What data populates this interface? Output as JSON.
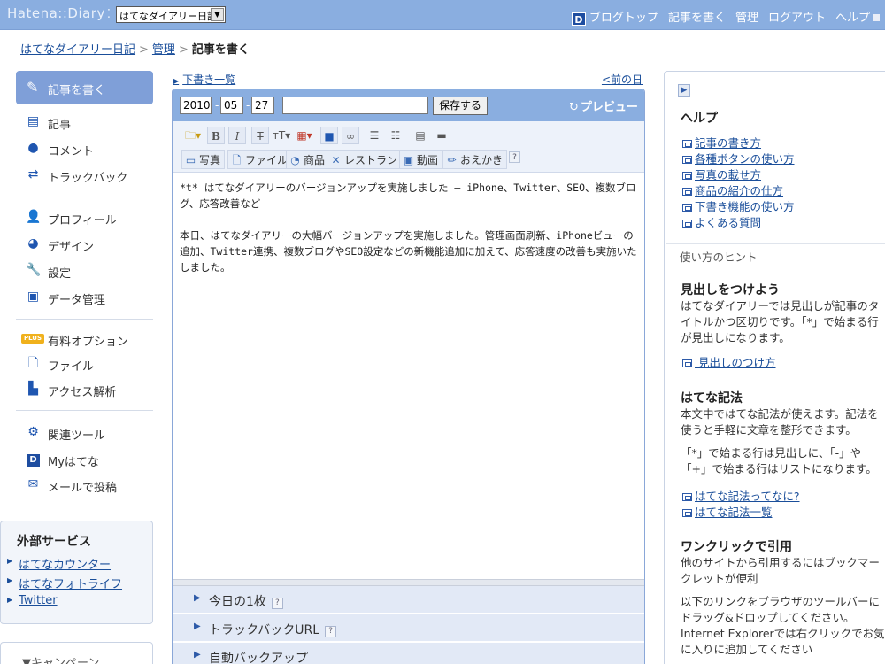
{
  "topbar": {
    "logo": "Hatena::Diary",
    "logo_mark": "⁚",
    "blog_select": "はてなダイアリー日記",
    "nav": [
      "ブログトップ",
      "記事を書く",
      "管理",
      "ログアウト",
      "ヘルプ"
    ],
    "d_badge": "D"
  },
  "breadcrumb": {
    "home": "はてなダイアリー日記",
    "admin": "管理",
    "current": "記事を書く",
    "sep": ">"
  },
  "sidebar": {
    "write_button": "記事を書く",
    "group1": [
      "記事",
      "コメント",
      "トラックバック"
    ],
    "group2": [
      "プロフィール",
      "デザイン",
      "設定",
      "データ管理"
    ],
    "plus_badge": "PLUS",
    "group3": [
      "有料オプション",
      "ファイル",
      "アクセス解析"
    ],
    "group4": [
      "関連ツール",
      "Myはてな",
      "メールで投稿"
    ],
    "external_title": "外部サービス",
    "external_links": [
      "はてなカウンター",
      "はてなフォトライフ",
      "Twitter"
    ],
    "campaign": "キャンペーン"
  },
  "editor": {
    "draft_list": "下書き一覧",
    "prev_day": "<前の日",
    "year": "2010",
    "month": "05",
    "day": "27",
    "title_value": "",
    "save_button": "保存する",
    "preview": "プレビュー",
    "tools_row2": [
      "写真",
      "ファイル",
      "商品",
      "レストラン",
      "動画",
      "おえかき"
    ],
    "help_mark": "?",
    "body": [
      "*t* はてなダイアリーのバージョンアップを実施しました – iPhone、Twitter、SEO、複数ブログ、応答改善など",
      "本日、はてなダイアリーの大幅バージョンアップを実施しました。管理画面刷新、iPhoneビューの追加、Twitter連携、複数ブログやSEO設定などの新機能追加に加えて、応答速度の改善も実施いたしました。"
    ],
    "sections": [
      "今日の1枚",
      "トラックバックURL",
      "自動バックアップ"
    ]
  },
  "help": {
    "title": "ヘルプ",
    "links": [
      "記事の書き方",
      "各種ボタンの使い方",
      "写真の載せ方",
      "商品の紹介の仕方",
      "下書き機能の使い方",
      "よくある質問"
    ],
    "hints_header": "使い方のヒント",
    "h1_title": "見出しをつけよう",
    "h1_text": "はてなダイアリーでは見出しが記事のタイトルかつ区切りです。「*」で始まる行が見出しになります。",
    "h1_link": "見出しのつけ方",
    "h2_title": "はてな記法",
    "h2_text1": "本文中ではてな記法が使えます。記法を使うと手軽に文章を整形できます。",
    "h2_text2": "「*」で始まる行は見出しに、「-」や「+」で始まる行はリストになります。",
    "h2_links": [
      "はてな記法ってなに?",
      "はてな記法一覧"
    ],
    "h3_title": "ワンクリックで引用",
    "h3_text1": "他のサイトから引用するにはブックマークレットが便利",
    "h3_text2": "以下のリンクをブラウザのツールバーにドラッグ&ドロップしてください。Internet Explorerでは右クリックでお気に入りに追加してください"
  }
}
